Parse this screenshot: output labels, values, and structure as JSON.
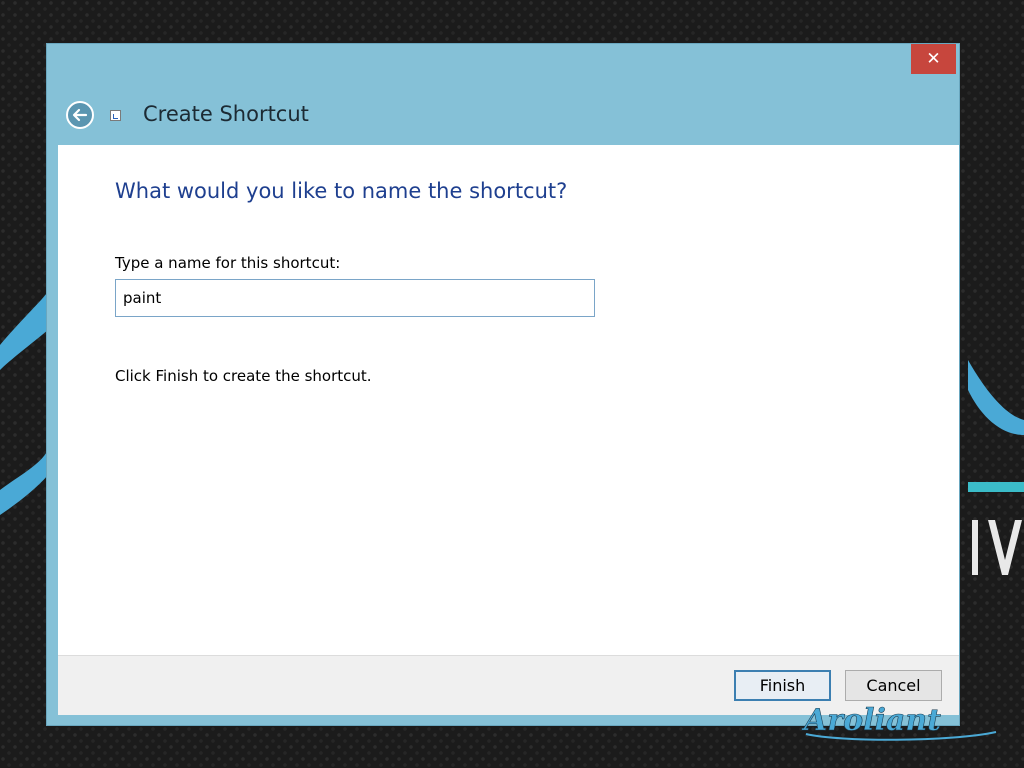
{
  "window": {
    "title": "Create Shortcut",
    "close_symbol": "✕"
  },
  "main": {
    "heading": "What would you like to name the shortcut?",
    "name_label": "Type a name for this shortcut:",
    "name_value": "paint",
    "hint": "Click Finish to create the shortcut."
  },
  "footer": {
    "finish_label": "Finish",
    "cancel_label": "Cancel"
  },
  "watermark": {
    "text": "Aroliant"
  },
  "colors": {
    "title_bar": "#85c1d7",
    "close_button": "#c7463d",
    "heading_text": "#1e3f8f",
    "primary_border": "#3c7fb1"
  },
  "icons": {
    "back": "back-arrow-icon",
    "shortcut": "shortcut-icon",
    "close": "close-icon"
  }
}
